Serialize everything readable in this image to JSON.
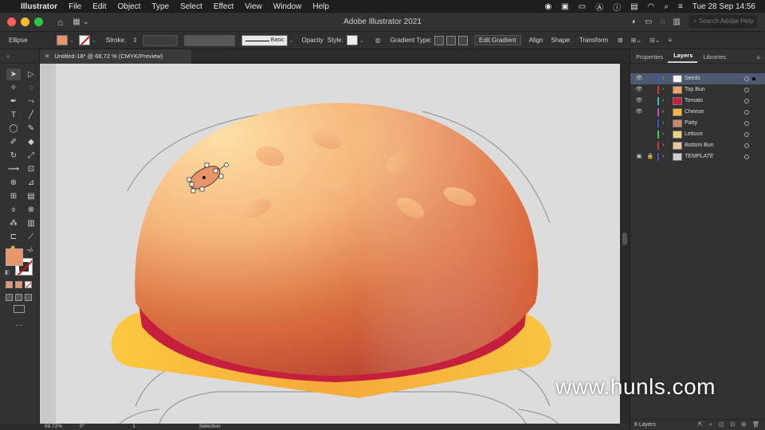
{
  "menubar": {
    "app_name": "Illustrator",
    "items": [
      "File",
      "Edit",
      "Object",
      "Type",
      "Select",
      "Effect",
      "View",
      "Window",
      "Help"
    ],
    "clock": "Tue 28 Sep  14:56"
  },
  "titlebar": {
    "title": "Adobe Illustrator 2021",
    "search_placeholder": "Search Adobe Help"
  },
  "controlbar": {
    "selection_type": "Ellipse",
    "stroke_label": "Stroke:",
    "brush_label": "Basic",
    "opacity_label": "Opacity",
    "style_label": "Style:",
    "gradient_type_label": "Gradient Type:",
    "edit_gradient": "Edit Gradient",
    "align": "Align",
    "shape": "Shape:",
    "transform": "Transform",
    "fill_color": "#e8956a"
  },
  "document": {
    "tab_label": "Untitled-18* @ 68,72 % (CMYK/Preview)"
  },
  "tools": {
    "fill_color": "#e8956a"
  },
  "panel": {
    "tabs": [
      "Properties",
      "Layers",
      "Libraries"
    ],
    "active_tab": "Layers",
    "layers": [
      {
        "name": "Seeds",
        "color": "#3d56c9",
        "visible": true,
        "locked": false,
        "selected": true
      },
      {
        "name": "Top Bun",
        "color": "#d23a3a",
        "visible": true,
        "locked": false,
        "selected": false
      },
      {
        "name": "Tomato",
        "color": "#27c4c4",
        "visible": true,
        "locked": false,
        "selected": false
      },
      {
        "name": "Cheese",
        "color": "#c44dc4",
        "visible": true,
        "locked": false,
        "selected": false
      },
      {
        "name": "Patty",
        "color": "#3d56c9",
        "visible": false,
        "locked": false,
        "selected": false
      },
      {
        "name": "Lettuce",
        "color": "#3ed15a",
        "visible": false,
        "locked": false,
        "selected": false
      },
      {
        "name": "Bottom Bun",
        "color": "#d23a3a",
        "visible": false,
        "locked": false,
        "selected": false
      },
      {
        "name": "TEMPLATE",
        "color": "#3d56c9",
        "visible": true,
        "locked": true,
        "selected": false
      }
    ],
    "footer_count": "8 Layers"
  },
  "status": {
    "zoom": "68,72%",
    "rotation": "0°",
    "artboard": "1",
    "tool": "Selection"
  },
  "watermark": "www.hunls.com"
}
